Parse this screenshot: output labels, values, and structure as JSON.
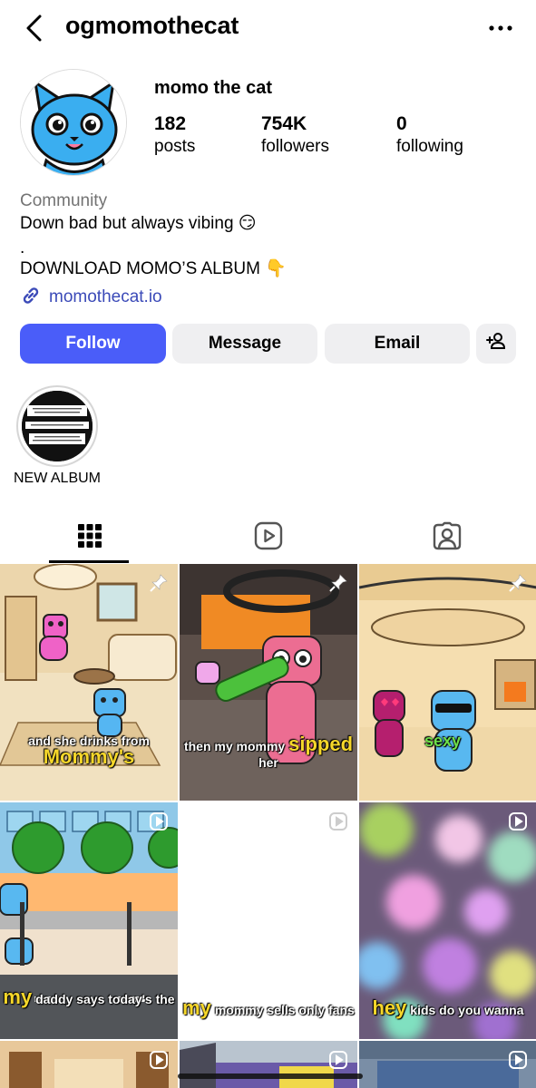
{
  "header": {
    "username": "ogmomothecat"
  },
  "profile": {
    "display_name": "momo the cat",
    "stats": [
      {
        "value": "182",
        "label": "posts"
      },
      {
        "value": "754K",
        "label": "followers"
      },
      {
        "value": "0",
        "label": "following"
      }
    ],
    "category": "Community",
    "bio_line1": "Down bad but always vibing 😏",
    "bio_line2": ".",
    "bio_line3": "DOWNLOAD MOMO’S ALBUM 👇",
    "link": "momothecat.io"
  },
  "actions": {
    "follow": "Follow",
    "message": "Message",
    "email": "Email"
  },
  "highlights": [
    {
      "label": "NEW ALBUM"
    }
  ],
  "tabs": [
    "posts-grid",
    "reels",
    "tagged"
  ],
  "posts": [
    {
      "pinned": true,
      "caption_pre": "and she drinks from",
      "caption_big": "Mommy's",
      "caption_post": ""
    },
    {
      "pinned": true,
      "caption_pre": "then my mommy",
      "caption_big": "sipped",
      "caption_post": "her"
    },
    {
      "pinned": true,
      "caption_pre": "",
      "caption_big": "sexy",
      "caption_post": ""
    },
    {
      "reel": true,
      "caption_pre": "",
      "caption_big": "my",
      "caption_post": "daddy says today's the"
    },
    {
      "reel": true,
      "caption_pre": "",
      "caption_big": "my",
      "caption_post": "mommy sells only fans"
    },
    {
      "reel": true,
      "caption_pre": "",
      "caption_big": "hey",
      "caption_post": "kids do you wanna"
    }
  ],
  "colors": {
    "follow": "#4a5df9",
    "link": "#3b4ab8",
    "secondary_button": "#efeff1",
    "caption_highlight": "#f6d72a"
  }
}
